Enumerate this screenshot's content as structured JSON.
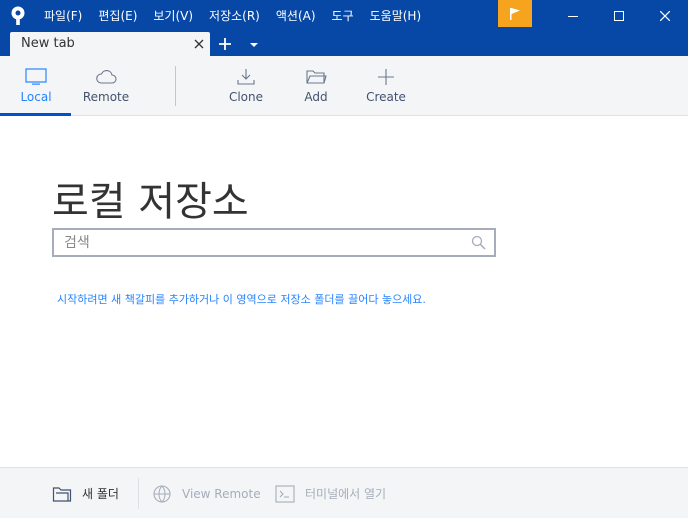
{
  "menu": [
    "파일(F)",
    "편집(E)",
    "보기(V)",
    "저장소(R)",
    "액션(A)",
    "도구",
    "도움말(H)"
  ],
  "tab": {
    "title": "New tab"
  },
  "toolbar": {
    "local": "Local",
    "remote": "Remote",
    "clone": "Clone",
    "add": "Add",
    "create": "Create"
  },
  "main": {
    "title": "로컬 저장소",
    "search_placeholder": "검색",
    "hint": "시작하려면 새 책갈피를 추가하거나 이 영역으로 저장소 폴더를 끌어다 놓으세요."
  },
  "bottom": {
    "new_folder": "새 폴더",
    "view_remote": "View Remote",
    "open_terminal": "터미널에서 열기"
  },
  "colors": {
    "titlebar": "#0747a6",
    "accent": "#2684ff",
    "flag": "#f6a31d"
  },
  "icons": [
    "app-logo-icon",
    "flag-icon",
    "minimize-icon",
    "maximize-icon",
    "close-icon",
    "tab-close-icon",
    "plus-icon",
    "chevron-down-icon",
    "monitor-icon",
    "cloud-icon",
    "download-icon",
    "folder-icon",
    "search-icon",
    "globe-icon",
    "terminal-icon"
  ]
}
